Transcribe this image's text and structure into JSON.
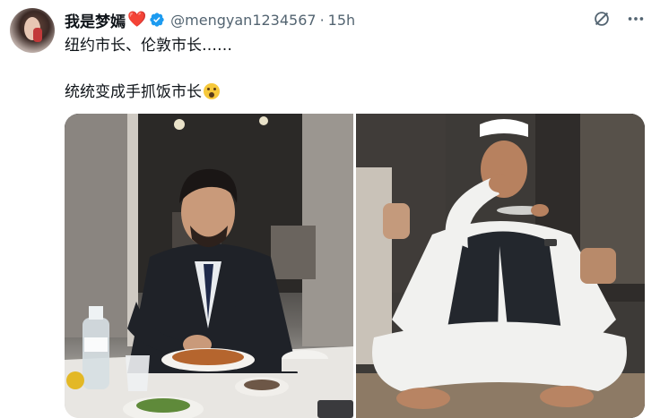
{
  "author": {
    "name": "我是梦嫣",
    "name_emoji": "❤️",
    "handle": "@mengyan1234567",
    "time": "15h",
    "separator": "·"
  },
  "tweet": {
    "line1": "纽约市长、伦敦市长……",
    "line2": "统统变成手抓饭市长"
  },
  "icons": {
    "verified": "verified-badge-icon",
    "grok": "grok-icon",
    "more": "more-icon",
    "emoji": "astonished-face-emoji"
  },
  "colors": {
    "text": "#0f1419",
    "muted": "#536471",
    "verified_blue": "#1d9bf0",
    "heart": "#e0245e"
  }
}
